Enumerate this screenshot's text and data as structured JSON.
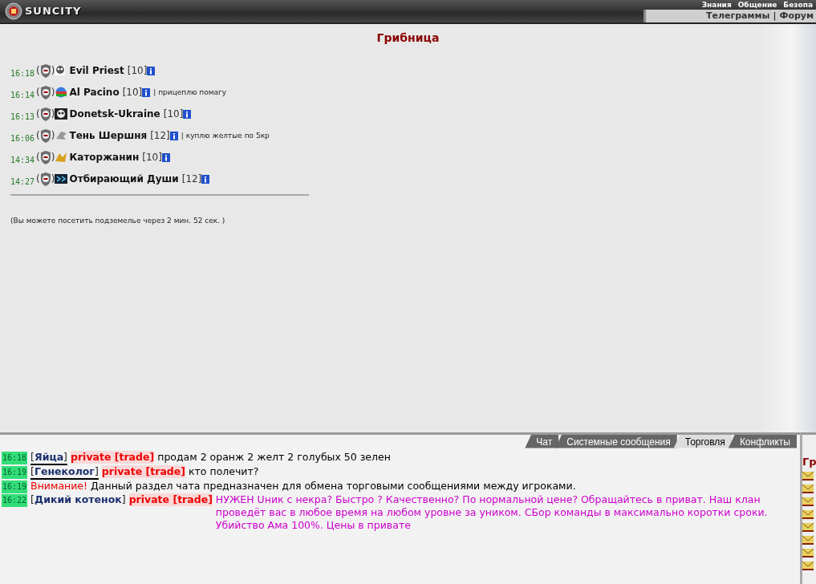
{
  "header": {
    "logo": "SUNCITY",
    "menu": [
      "Знания",
      "Общение",
      "Безопа"
    ],
    "links": [
      "Телеграммы",
      "Форум"
    ],
    "separator": "|"
  },
  "room": {
    "title": "Грибница",
    "users": [
      {
        "time": "16:18",
        "paren": [
          "(",
          ")"
        ],
        "name": "Evil Priest",
        "level": "[10]"
      },
      {
        "time": "16:14",
        "paren": [
          "(",
          ")"
        ],
        "name": "Al Pacino",
        "level": "[10]",
        "note": "| прицеплю помагу"
      },
      {
        "time": "16:13",
        "paren": [
          "(",
          ")"
        ],
        "name": "Donetsk-Ukraine",
        "level": "[10]"
      },
      {
        "time": "16:06",
        "paren": [
          "(",
          ")"
        ],
        "name": "Тень Шершня",
        "level": "[12]",
        "note": "| куплю желтые по 5кр"
      },
      {
        "time": "14:34",
        "paren": [
          "(",
          ")"
        ],
        "name": "Каторжанин",
        "level": "[10]"
      },
      {
        "time": "14:27",
        "paren": [
          "(",
          ")"
        ],
        "name": "Отбирающий Души",
        "level": "[12]"
      }
    ],
    "notice": "(Вы можете посетить подземелье через 2 мин. 52 сек. )"
  },
  "chat": {
    "tabs": [
      {
        "label": "Чат",
        "selected": false
      },
      {
        "label": "Системные сообщения",
        "selected": false
      },
      {
        "label": "Торговля",
        "selected": true
      },
      {
        "label": "Конфликты",
        "selected": false
      }
    ],
    "messages": [
      {
        "kind": "private",
        "time": "16:18",
        "name": "[**Яйца**]",
        "underlined": true,
        "tag": "private [trade]",
        "text": "продам 2 оранж 2 желт 2 голубых 50 зелен",
        "color": "#000000"
      },
      {
        "kind": "private",
        "time": "16:19",
        "name": "[**Генеколог**]",
        "underlined": true,
        "tag": "private [trade]",
        "text": "кто полечит?",
        "color": "#000000"
      },
      {
        "kind": "notice",
        "time": "16:19",
        "label": "Внимание!",
        "text": "Данный раздел чата предназначен для обмена торговыми сообщениями между игроками.",
        "color": "#000000"
      },
      {
        "kind": "private",
        "time": "16:22",
        "name": "[**Дикий котенок**]",
        "underlined": false,
        "tag": "private [trade]",
        "text": "НУЖЕН Uник с некра? Быстро ? Качественно? По нормальной цене? Обращайтесь в приват. Наш клан проведёт вас в любое время на любом уровне за уником. СБор команды в максимально коротки сроки. Убийство Ама 100%. Цены в привате",
        "color": "#cc00cc"
      }
    ]
  },
  "side": {
    "title": "Гр"
  }
}
